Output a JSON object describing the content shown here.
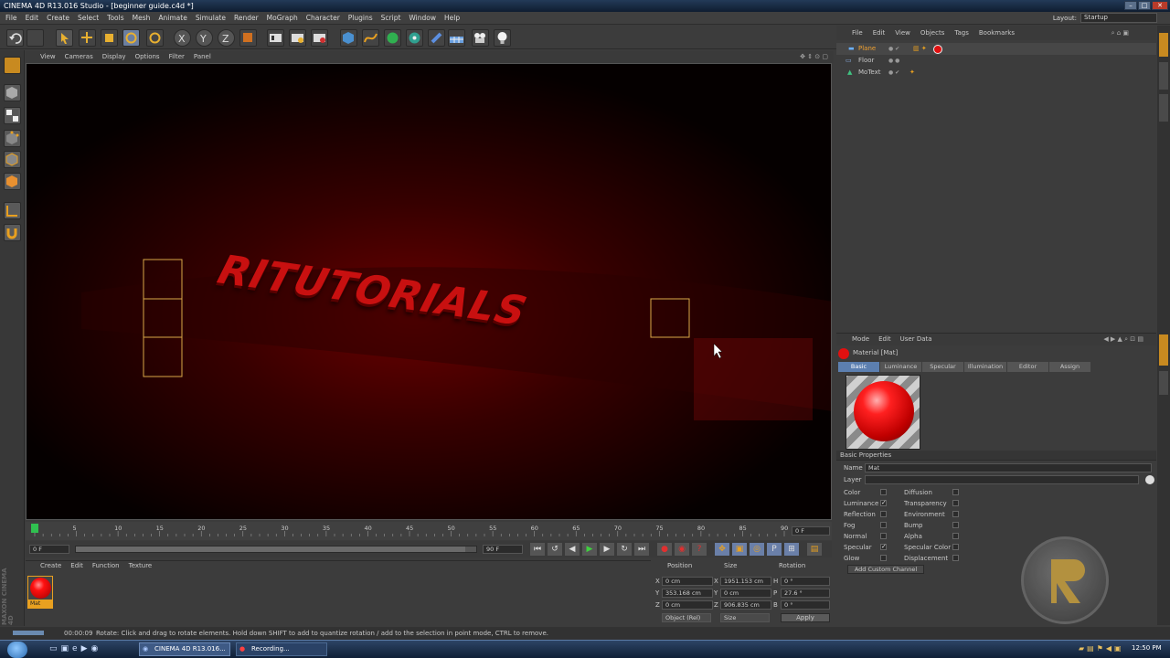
{
  "window": {
    "title": "CINEMA 4D R13.016 Studio - [beginner guide.c4d *]"
  },
  "menu": [
    "File",
    "Edit",
    "Create",
    "Select",
    "Tools",
    "Mesh",
    "Animate",
    "Simulate",
    "Render",
    "MoGraph",
    "Character",
    "Plugins",
    "Script",
    "Window",
    "Help"
  ],
  "layout": {
    "label": "Layout:",
    "value": "Startup"
  },
  "viewport": {
    "menu": [
      "View",
      "Cameras",
      "Display",
      "Options",
      "Filter",
      "Panel"
    ],
    "scene_text": "RITUTORIALS"
  },
  "object_manager": {
    "menu": [
      "File",
      "Edit",
      "View",
      "Objects",
      "Tags",
      "Bookmarks"
    ],
    "objects": [
      {
        "name": "Plane",
        "selected": true
      },
      {
        "name": "Floor",
        "selected": false
      },
      {
        "name": "MoText",
        "selected": false
      }
    ]
  },
  "attribute_manager": {
    "menu": [
      "Mode",
      "Edit",
      "User Data"
    ],
    "title": "Material [Mat]",
    "tabs": [
      "Basic",
      "Luminance",
      "Specular",
      "Illumination",
      "Editor",
      "Assign"
    ],
    "active_tab": "Basic",
    "section": "Basic Properties",
    "name_label": "Name",
    "name_value": "Mat",
    "layer_label": "Layer",
    "channels_left": [
      {
        "label": "Color",
        "checked": false
      },
      {
        "label": "Luminance",
        "checked": true
      },
      {
        "label": "Reflection",
        "checked": false
      },
      {
        "label": "Fog",
        "checked": false
      },
      {
        "label": "Normal",
        "checked": false
      },
      {
        "label": "Specular",
        "checked": true
      },
      {
        "label": "Glow",
        "checked": false
      }
    ],
    "channels_right": [
      {
        "label": "Diffusion",
        "checked": false
      },
      {
        "label": "Transparency",
        "checked": false
      },
      {
        "label": "Environment",
        "checked": false
      },
      {
        "label": "Bump",
        "checked": false
      },
      {
        "label": "Alpha",
        "checked": false
      },
      {
        "label": "Specular Color",
        "checked": false
      },
      {
        "label": "Displacement",
        "checked": false
      }
    ],
    "add_channel_button": "Add Custom Channel"
  },
  "timeline": {
    "ticks": [
      "0",
      "5",
      "10",
      "15",
      "20",
      "25",
      "30",
      "35",
      "40",
      "45",
      "50",
      "55",
      "60",
      "65",
      "70",
      "75",
      "80",
      "85",
      "90"
    ],
    "current_frame": "0 F",
    "end_field": "0 F"
  },
  "transport": {
    "start": "0 F",
    "end": "90 F",
    "range_end": "90 F"
  },
  "material_manager": {
    "menu": [
      "Create",
      "Edit",
      "Function",
      "Texture"
    ],
    "materials": [
      {
        "name": "Mat"
      }
    ],
    "brand_side_text": "MAXON CINEMA 4D"
  },
  "coordinates": {
    "headers": [
      "Position",
      "Size",
      "Rotation"
    ],
    "rows": [
      {
        "axis": "X",
        "pos": "0 cm",
        "size_axis": "X",
        "size": "1951.153 cm",
        "rot_axis": "H",
        "rot": "0 °"
      },
      {
        "axis": "Y",
        "pos": "353.168 cm",
        "size_axis": "Y",
        "size": "0 cm",
        "rot_axis": "P",
        "rot": "27.6 °"
      },
      {
        "axis": "Z",
        "pos": "0 cm",
        "size_axis": "Z",
        "size": "906.835 cm",
        "rot_axis": "B",
        "rot": "0 °"
      }
    ],
    "mode": "Object (Rel)",
    "size_mode": "Size",
    "apply": "Apply"
  },
  "status": {
    "time": "00:00:09",
    "message": "Rotate: Click and drag to rotate elements. Hold down SHIFT to add to quantize rotation / add to the selection in point mode, CTRL to remove."
  },
  "taskbar": {
    "tasks": [
      "CINEMA 4D R13.016...",
      "Recording..."
    ],
    "clock": "12:50 PM"
  },
  "colors": {
    "accent": "#f0a030",
    "selected_tab": "#5c7fb0",
    "scene_red": "#c81010"
  }
}
